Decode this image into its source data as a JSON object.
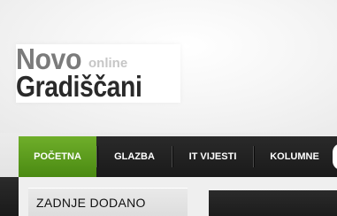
{
  "logo": {
    "word1": "Novo",
    "word_small": "online",
    "word2": "Gradiščani"
  },
  "nav": {
    "items": [
      {
        "label": "POČETNA",
        "active": true
      },
      {
        "label": "GLAZBA",
        "active": false
      },
      {
        "label": "IT VIJESTI",
        "active": false
      },
      {
        "label": "KOLUMNE",
        "active": false
      }
    ]
  },
  "sidebar": {
    "title": "ZADNJE DODANO"
  },
  "colors": {
    "accent": "#5c9b1c",
    "navbar": "#1f1f1f",
    "logo_dark": "#2a2a2a",
    "logo_gray": "#7b7b7b"
  }
}
